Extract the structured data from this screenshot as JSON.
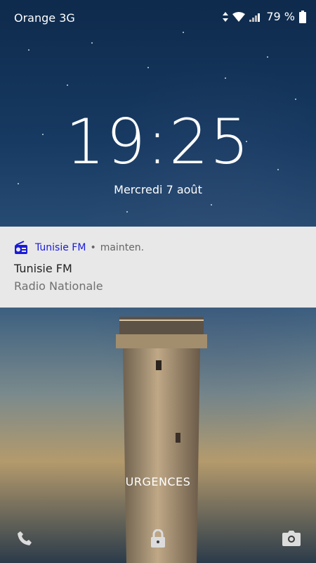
{
  "status_bar": {
    "carrier": "Orange 3G",
    "battery_percent": "79 %",
    "icons": [
      "data-arrows-icon",
      "wifi-icon",
      "signal-icon",
      "battery-icon"
    ]
  },
  "lock_screen": {
    "time": "19:25",
    "date": "Mercredi 7 août",
    "emergency_label": "URGENCES"
  },
  "notification": {
    "app_icon": "radio-icon",
    "app_name": "Tunisie FM",
    "separator": "•",
    "timestamp": "mainten.",
    "title": "Tunisie FM",
    "text": "Radio Nationale",
    "accent_color": "#1a1ad9"
  },
  "bottom_actions": {
    "left": "phone-icon",
    "center": "lock-icon",
    "right": "camera-icon"
  }
}
